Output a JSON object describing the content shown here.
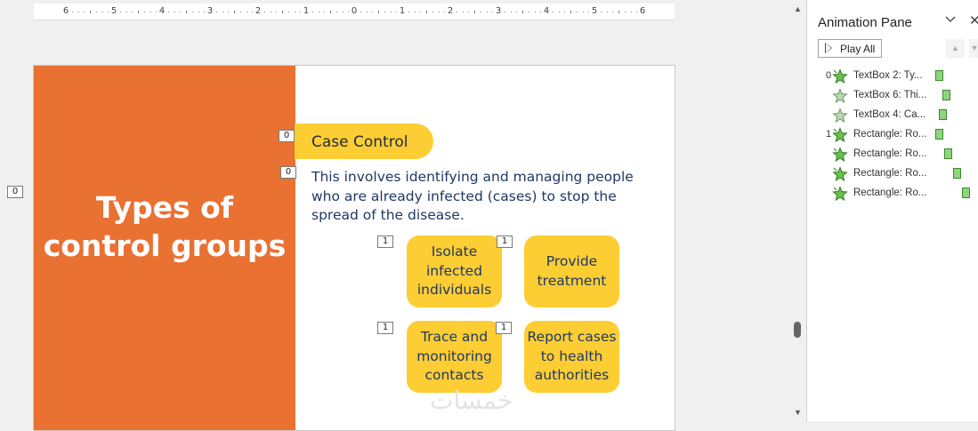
{
  "ruler": {
    "labels": [
      "6",
      "5",
      "4",
      "3",
      "2",
      "1",
      "0",
      "1",
      "2",
      "3",
      "4",
      "5",
      "6"
    ]
  },
  "left_marker": "0",
  "slide": {
    "title": "Types of control groups",
    "pill_label": "Case Control",
    "description": "This involves identifying and managing people who are already infected (cases) to stop the spread of the disease.",
    "cards": [
      "Isolate infected individuals",
      "Provide treatment",
      "Trace and monitoring contacts",
      "Report cases to health authorities"
    ],
    "tags": {
      "pill": "0",
      "desc": "0",
      "card1": "1",
      "card2": "1",
      "card3": "1",
      "card4": "1"
    },
    "colors": {
      "orange": "#e97132",
      "yellow": "#fdcd34"
    }
  },
  "watermark": "خمسات",
  "pane": {
    "title": "Animation Pane",
    "play_all": "Play All",
    "items": [
      {
        "group": "0",
        "label": "TextBox 2: Ty...",
        "icon": "entrance-star-icon"
      },
      {
        "group": "",
        "label": "TextBox 6: Thi...",
        "icon": "with-previous-star-icon"
      },
      {
        "group": "",
        "label": "TextBox 4: Ca...",
        "icon": "with-previous-star-icon"
      },
      {
        "group": "1",
        "label": "Rectangle: Ro...",
        "icon": "entrance-star-icon"
      },
      {
        "group": "",
        "label": "Rectangle: Ro...",
        "icon": "entrance-star-icon"
      },
      {
        "group": "",
        "label": "Rectangle: Ro...",
        "icon": "entrance-star-icon"
      },
      {
        "group": "",
        "label": "Rectangle: Ro...",
        "icon": "entrance-star-icon"
      }
    ]
  }
}
